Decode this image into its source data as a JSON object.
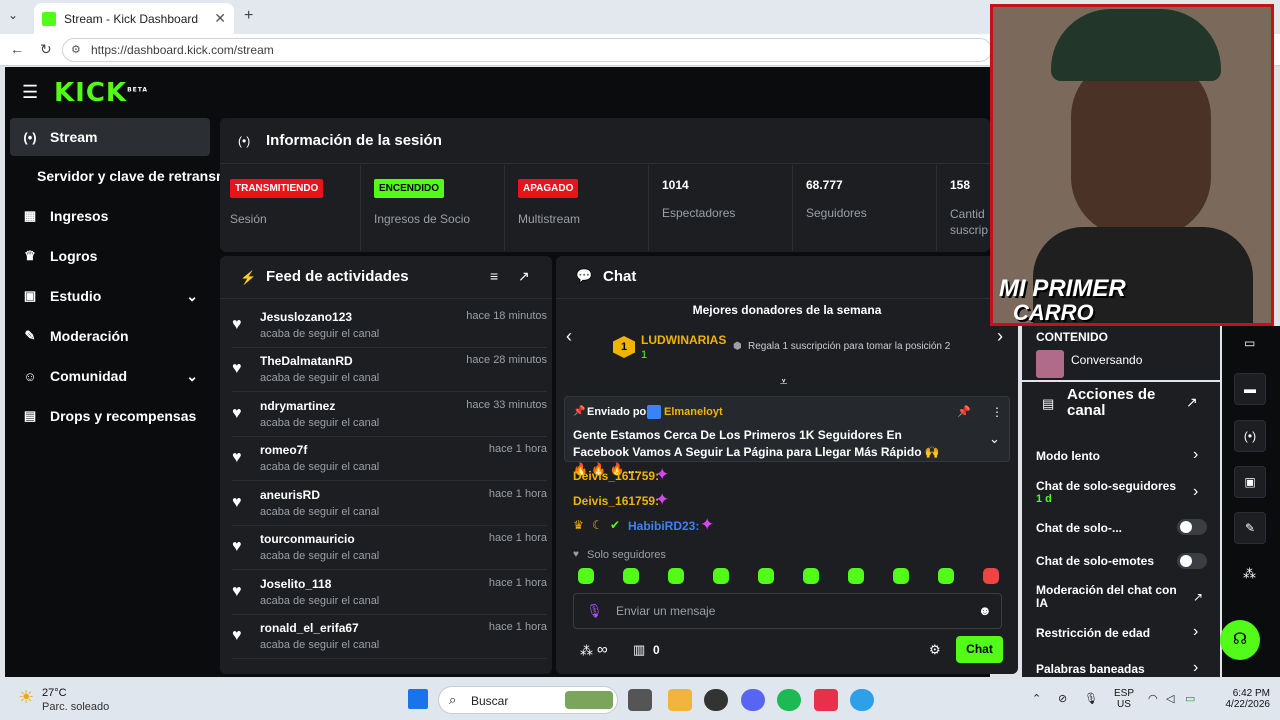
{
  "browser": {
    "tab_title": "Stream - Kick Dashboard",
    "url": "https://dashboard.kick.com/stream"
  },
  "logo": {
    "text": "KICK",
    "beta": "BETA"
  },
  "sidebar": {
    "items": [
      {
        "label": "Stream",
        "icon": "stream-icon"
      },
      {
        "label": "Servidor y clave de retransm"
      },
      {
        "label": "Ingresos",
        "icon": "bank-icon"
      },
      {
        "label": "Logros",
        "icon": "trophy-icon"
      },
      {
        "label": "Estudio",
        "icon": "camera-icon"
      },
      {
        "label": "Moderación",
        "icon": "wrench-icon"
      },
      {
        "label": "Comunidad",
        "icon": "users-icon"
      },
      {
        "label": "Drops y recompensas",
        "icon": "drops-icon"
      }
    ]
  },
  "session": {
    "title": "Información de la sesión",
    "stats": [
      {
        "badge": "TRANSMITIENDO",
        "label": "Sesión"
      },
      {
        "badge": "ENCENDIDO",
        "label": "Ingresos de Socio"
      },
      {
        "badge": "APAGADO",
        "label": "Multistream"
      },
      {
        "value": "1014",
        "label": "Espectadores"
      },
      {
        "value": "68.777",
        "label": "Seguidores"
      },
      {
        "value": "158",
        "label": "Cantid suscrip"
      }
    ]
  },
  "feed": {
    "title": "Feed de actividades",
    "items": [
      {
        "user": "Jesuslozano123",
        "action": "acaba de seguir el canal",
        "time": "hace 18 minutos"
      },
      {
        "user": "TheDalmatanRD",
        "action": "acaba de seguir el canal",
        "time": "hace 28 minutos"
      },
      {
        "user": "ndrymartinez",
        "action": "acaba de seguir el canal",
        "time": "hace 33 minutos"
      },
      {
        "user": "romeo7f",
        "action": "acaba de seguir el canal",
        "time": "hace 1 hora"
      },
      {
        "user": "aneurisRD",
        "action": "acaba de seguir el canal",
        "time": "hace 1 hora"
      },
      {
        "user": "tourconmauricio",
        "action": "acaba de seguir el canal",
        "time": "hace 1 hora"
      },
      {
        "user": "Joselito_118",
        "action": "acaba de seguir el canal",
        "time": "hace 1 hora"
      },
      {
        "user": "ronald_el_erifa67",
        "action": "acaba de seguir el canal",
        "time": "hace 1 hora"
      }
    ]
  },
  "chat": {
    "title": "Chat",
    "top_donors": "Mejores donadores de la semana",
    "donor_name": "LUDWINARIAS",
    "donor_count": "1",
    "donor_rank": "1",
    "gift_hint": "Regala 1 suscripción para tomar la posición 2",
    "pinned_by": "Enviado por",
    "pinned_user": "Elmaneloyt",
    "pinned_text": "Gente Estamos Cerca De Los Primeros 1K Seguidores En Facebook Vamos A Seguir La Página para Llegar Más Rápido 🙌 🔥 🔥 🔥 ...",
    "messages": [
      {
        "user": "Deivis_161759:"
      },
      {
        "user": "Deivis_161759:"
      },
      {
        "user": "HabibiRD23:"
      }
    ],
    "followers_only": "Solo seguidores",
    "placeholder": "Enviar un mensaje",
    "send": "Chat",
    "points": "0",
    "infinity": "∞"
  },
  "overlay_text": {
    "line1": "MI PRIMER",
    "line2": "CARRO"
  },
  "right": {
    "content_label": "CONTENIDO",
    "content_item": "Conversando",
    "actions_title": "Acciones de canal",
    "rows": [
      {
        "label": "Modo lento"
      },
      {
        "label": "Chat de solo-seguidores",
        "sub": "1 d"
      },
      {
        "label": "Chat de solo-..."
      },
      {
        "label": "Chat de solo-emotes"
      },
      {
        "label": "Moderación del chat con IA"
      },
      {
        "label": "Restricción de edad"
      },
      {
        "label": "Palabras baneadas"
      }
    ]
  },
  "taskbar": {
    "temp": "27°C",
    "weather": "Parc. soleado",
    "search": "Buscar",
    "lang1": "ESP",
    "lang2": "US",
    "time": "6:42 PM",
    "date": "4/22/2026"
  }
}
